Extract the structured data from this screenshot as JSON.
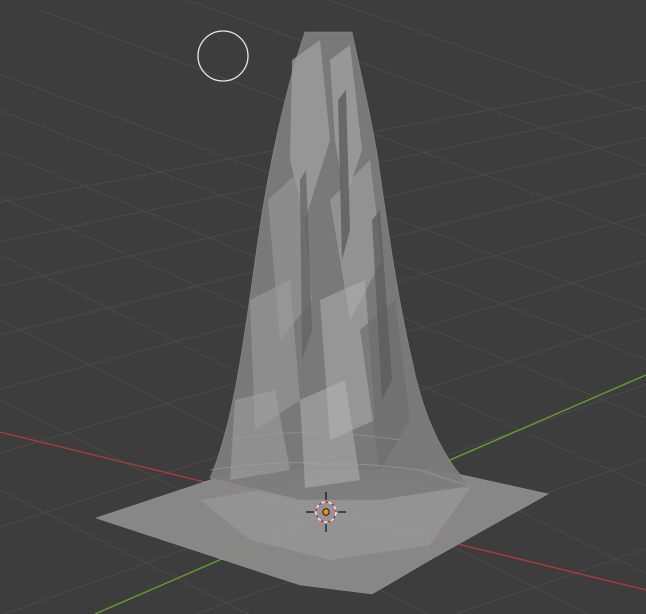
{
  "viewport": {
    "background_color": "#3d3d3d",
    "grid_color": "#4a4a4a",
    "x_axis_color": "#a83a44",
    "y_axis_color": "#6b9a2f",
    "mesh_color": "#8a8a8a",
    "mesh_highlight_color": "#a6a6a6",
    "mesh_shadow_color": "#6a6a6a",
    "origin_color": "#ff8a1a",
    "cursor_color": "#e6e6e6"
  },
  "icons": {
    "cursor": "3d-cursor-icon",
    "origin": "object-origin-icon",
    "brush": "brush-circle-icon"
  }
}
